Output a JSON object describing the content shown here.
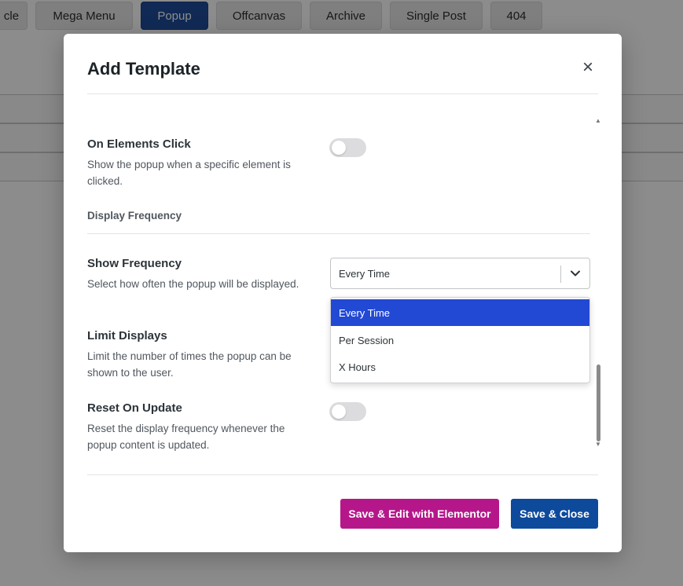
{
  "background": {
    "tabs": [
      {
        "label": "cle",
        "active": false
      },
      {
        "label": "Mega Menu",
        "active": false
      },
      {
        "label": "Popup",
        "active": true
      },
      {
        "label": "Offcanvas",
        "active": false
      },
      {
        "label": "Archive",
        "active": false
      },
      {
        "label": "Single Post",
        "active": false
      },
      {
        "label": "404",
        "active": false
      }
    ]
  },
  "modal": {
    "title": "Add Template",
    "close_symbol": "×",
    "settings": {
      "on_elements_click": {
        "label": "On Elements Click",
        "description": "Show the popup when a specific element is clicked.",
        "enabled": false
      },
      "display_frequency_heading": "Display Frequency",
      "show_frequency": {
        "label": "Show Frequency",
        "description": "Select how often the popup will be displayed.",
        "selected": "Every Time",
        "options": [
          "Every Time",
          "Per Session",
          "X Hours"
        ]
      },
      "limit_displays": {
        "label": "Limit Displays",
        "description": "Limit the number of times the popup can be shown to the user."
      },
      "reset_on_update": {
        "label": "Reset On Update",
        "description": "Reset the display frequency whenever the popup content is updated.",
        "enabled": false
      }
    },
    "buttons": {
      "save_edit": "Save & Edit with Elementor",
      "save_close": "Save & Close"
    }
  },
  "colors": {
    "accent_blue": "#2249d4",
    "elementor_pink": "#b5178a",
    "primary_blue": "#0e4a9c"
  },
  "icons": {
    "close": "close-icon",
    "select_arrow": "chevron-down-icon"
  }
}
